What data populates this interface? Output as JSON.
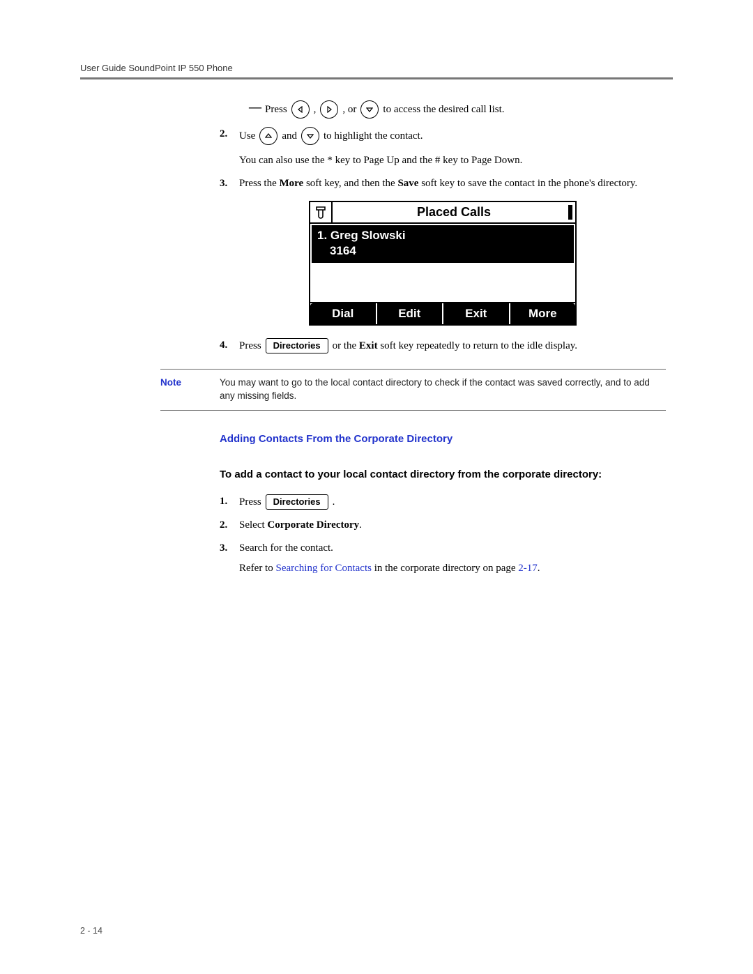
{
  "header": {
    "running_title": "User Guide SoundPoint IP 550 Phone"
  },
  "section1": {
    "dash_item": {
      "press": "Press",
      "sep1": ",",
      "sep2": ", or",
      "rest": "to access the desired call list."
    },
    "step2": {
      "num": "2.",
      "t1": "Use",
      "t2": "and",
      "t3": "to highlight the contact."
    },
    "step2_note": "You can also use the * key to Page Up and the # key to Page Down.",
    "step3": {
      "num": "3.",
      "t1": "Press the ",
      "more": "More",
      "t2": " soft key, and then the ",
      "save": "Save",
      "t3": " soft key to save the contact in the phone's directory."
    },
    "step4": {
      "num": "4.",
      "t1": "Press",
      "btn": "Directories",
      "t2": "or the ",
      "exit": "Exit",
      "t3": " soft key repeatedly to return to the idle display."
    }
  },
  "phone": {
    "title": "Placed Calls",
    "entry_name": "1. Greg Slowski",
    "entry_number": "3164",
    "softkeys": [
      "Dial",
      "Edit",
      "Exit",
      "More"
    ]
  },
  "note": {
    "label": "Note",
    "text": "You may want to go to the local contact directory to check if the contact was saved correctly, and to add any missing fields."
  },
  "section2": {
    "heading": "Adding Contacts From the Corporate Directory",
    "lead": "To add a contact to your local contact directory from the corporate directory:",
    "step1": {
      "num": "1.",
      "t1": "Press",
      "btn": "Directories",
      "t2": "."
    },
    "step2": {
      "num": "2.",
      "t1": "Select ",
      "corp": "Corporate Directory",
      "t2": "."
    },
    "step3": {
      "num": "3.",
      "t1": "Search for the contact.",
      "refer1": "Refer to ",
      "link": "Searching for Contacts",
      "refer2": " in the corporate directory on page ",
      "pageref": "2-17",
      "refer3": "."
    }
  },
  "footer": {
    "page_num": "2 - 14"
  }
}
